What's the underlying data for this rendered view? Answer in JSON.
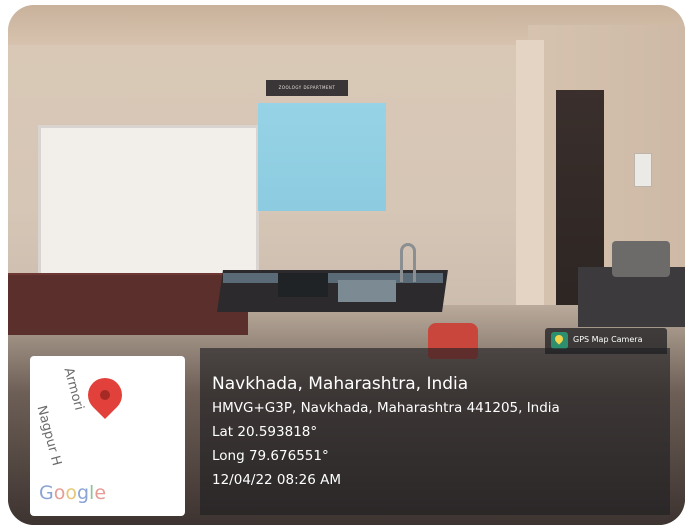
{
  "scene": {
    "department_sign": "ZOOLOGY DEPARTMENT"
  },
  "badge": {
    "label": "GPS Map Camera",
    "icon": "gps-map-camera-icon"
  },
  "map": {
    "road_label_1": "Armori",
    "road_label_2": "Nagpur H",
    "logo": {
      "g1": "G",
      "o1": "o",
      "o2": "o",
      "g2": "g",
      "l": "l",
      "e": "e"
    },
    "pin_icon": "map-pin-icon",
    "pin_color": "#e2403a"
  },
  "location": {
    "place": "Navkhada, Maharashtra, India",
    "address": "HMVG+G3P, Navkhada, Maharashtra 441205, India",
    "lat": "Lat 20.593818°",
    "long": "Long 79.676551°",
    "datetime": "12/04/22 08:26 AM"
  },
  "colors": {
    "overlay_bg": "#1e1e22",
    "text": "#ffffff"
  }
}
